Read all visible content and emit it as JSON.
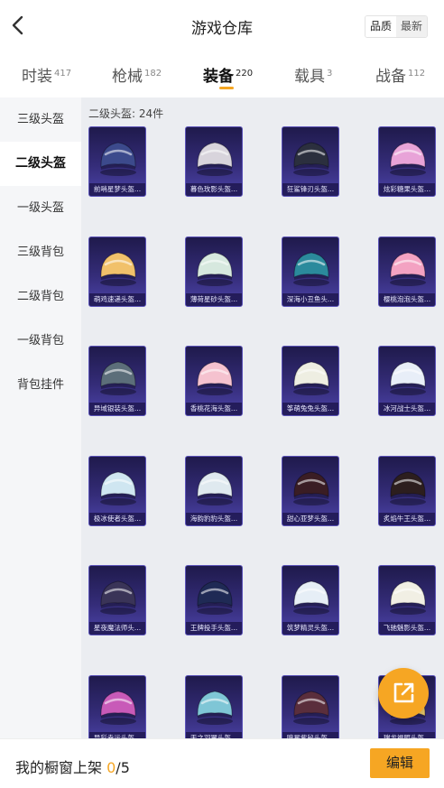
{
  "header": {
    "title": "游戏仓库",
    "sort_options": [
      "品质",
      "最新"
    ]
  },
  "tabs": [
    {
      "label": "时装",
      "count": "417"
    },
    {
      "label": "枪械",
      "count": "182"
    },
    {
      "label": "装备",
      "count": "220"
    },
    {
      "label": "载具",
      "count": "3"
    },
    {
      "label": "战备",
      "count": "112"
    }
  ],
  "sidebar": {
    "items": [
      "三级头盔",
      "二级头盔",
      "一级头盔",
      "三级背包",
      "二级背包",
      "一级背包",
      "背包挂件"
    ]
  },
  "grid": {
    "count_label": "二级头盔: 24件",
    "items": [
      {
        "name": "前哨星梦头盔...",
        "color": "#3c4a8c"
      },
      {
        "name": "暮色玫影头盔...",
        "color": "#d8d4dc"
      },
      {
        "name": "狂鲨锋刃头盔...",
        "color": "#2b2f3e"
      },
      {
        "name": "炫彩糖果头盔...",
        "color": "#e8a3d8"
      },
      {
        "name": "萌鸡速递头盔...",
        "color": "#f1c16b"
      },
      {
        "name": "薄荷星砂头盔...",
        "color": "#d6e8de"
      },
      {
        "name": "深海小丑鱼头...",
        "color": "#2b8a9c"
      },
      {
        "name": "樱桃泡泡头盔...",
        "color": "#f3a2c2"
      },
      {
        "name": "异域银装头盔...",
        "color": "#5c6e7a"
      },
      {
        "name": "香桃花海头盔...",
        "color": "#f5c2cf"
      },
      {
        "name": "筝萌兔兔头盔...",
        "color": "#eeeee2"
      },
      {
        "name": "冰河战士头盔...",
        "color": "#e8eef8"
      },
      {
        "name": "极冰使者头盔...",
        "color": "#cfe6f1"
      },
      {
        "name": "海韵豹豹头盔...",
        "color": "#dfe9ef"
      },
      {
        "name": "甜心亚梦头盔...",
        "color": "#3a1d24"
      },
      {
        "name": "炙焰牛王头盔...",
        "color": "#2c1e1e"
      },
      {
        "name": "星夜魔法师头...",
        "color": "#3a3458"
      },
      {
        "name": "王牌投手头盔...",
        "color": "#1f2a55"
      },
      {
        "name": "筑梦精灵头盔...",
        "color": "#e6eef6"
      },
      {
        "name": "飞驰魅影头盔...",
        "color": "#f1efe4"
      },
      {
        "name": "异彩幸运头盔...",
        "color": "#c85ab8"
      },
      {
        "name": "天之羽翼头盔...",
        "color": "#7fc6d6"
      },
      {
        "name": "暗星紫秘头盔...",
        "color": "#5a2e3c"
      },
      {
        "name": "瑞龙福照头盔...",
        "color": "#e9c86a"
      }
    ]
  },
  "bottom_bar": {
    "label": "我的橱窗上架",
    "current": "0",
    "total": "/5",
    "edit_label": "编辑"
  },
  "icons": {
    "back": "chevron-left-icon",
    "share": "share-external-icon"
  },
  "colors": {
    "accent": "#f6a623",
    "card_bg": "#342c78"
  }
}
